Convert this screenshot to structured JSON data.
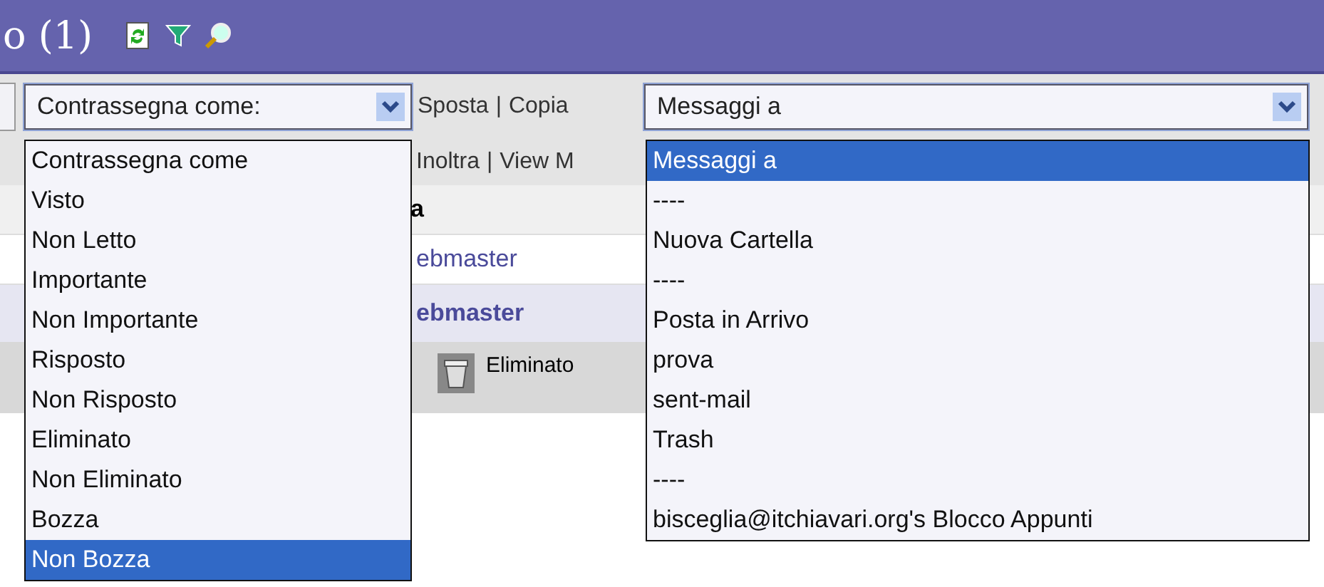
{
  "header": {
    "title": "o (1)"
  },
  "toolbar": {
    "mark_select": {
      "value": "Contrassegna come:",
      "expanded": true,
      "options": [
        {
          "label": "Contrassegna come",
          "selected": false
        },
        {
          "label": "Visto",
          "selected": false
        },
        {
          "label": "Non Letto",
          "selected": false
        },
        {
          "label": "Importante",
          "selected": false
        },
        {
          "label": "Non Importante",
          "selected": false
        },
        {
          "label": "Risposto",
          "selected": false
        },
        {
          "label": "Non Risposto",
          "selected": false
        },
        {
          "label": "Eliminato",
          "selected": false
        },
        {
          "label": "Non Eliminato",
          "selected": false
        },
        {
          "label": "Bozza",
          "selected": false
        },
        {
          "label": "Non Bozza",
          "selected": true
        }
      ]
    },
    "links": [
      "Sposta",
      "|",
      "Copia"
    ],
    "folder_select": {
      "value": "Messaggi a",
      "expanded": true,
      "options": [
        {
          "label": "Messaggi a",
          "selected": true
        },
        {
          "label": "----",
          "selected": false
        },
        {
          "label": "Nuova Cartella",
          "selected": false
        },
        {
          "label": "----",
          "selected": false
        },
        {
          "label": "Posta in Arrivo",
          "selected": false
        },
        {
          "label": "prova",
          "selected": false
        },
        {
          "label": "sent-mail",
          "selected": false
        },
        {
          "label": "Trash",
          "selected": false
        },
        {
          "label": "----",
          "selected": false
        },
        {
          "label": "bisceglia@itchiavari.org's Blocco Appunti",
          "selected": false
        }
      ]
    }
  },
  "actions_row": [
    "Inoltra",
    "|",
    "View M"
  ],
  "message_list": {
    "header": "a",
    "rows": [
      {
        "sender": "ebmaster",
        "unread": false
      },
      {
        "sender": "ebmaster",
        "unread": true
      }
    ],
    "status": "Eliminato"
  }
}
